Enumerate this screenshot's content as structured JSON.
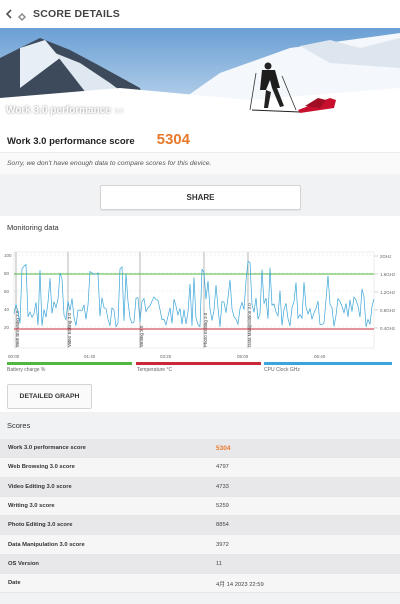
{
  "header": {
    "title": "SCORE DETAILS"
  },
  "hero": {
    "label": "Work 3.0 performance",
    "version": "3.0"
  },
  "score": {
    "label": "Work 3.0 performance score",
    "value": "5304"
  },
  "notice": "Sorry, we don't have enough data to compare scores for this device.",
  "share_label": "SHARE",
  "monitoring": {
    "title": "Monitoring data",
    "y_left_ticks": [
      "100",
      "80",
      "60",
      "40",
      "20"
    ],
    "y_right_ticks": [
      "2GHz",
      "1.6GHz",
      "1.2GHz",
      "0.8GHz",
      "0.4GHz"
    ],
    "x_ticks": [
      "00:00",
      "01:40",
      "03:20",
      "05:00",
      "06:40"
    ],
    "segment_labels": [
      "Web Browsing 3.0",
      "Video Editing 3.0",
      "Writing 3.0",
      "Photo Editing 3.0",
      "Data Manipulation 3.0"
    ],
    "legend": [
      {
        "label": "Battery charge %",
        "color": "#4fb83e"
      },
      {
        "label": "Temperature °C",
        "color": "#c8283a"
      },
      {
        "label": "CPU Clock GHz",
        "color": "#3aa5d8"
      }
    ]
  },
  "detailed_graph_label": "DETAILED GRAPH",
  "scores": {
    "title": "Scores",
    "rows": [
      {
        "name": "Work 3.0 performance score",
        "value": "5304"
      },
      {
        "name": "Web Browsing 3.0 score",
        "value": "4797"
      },
      {
        "name": "Video Editing 3.0 score",
        "value": "4733"
      },
      {
        "name": "Writing 3.0 score",
        "value": "5259"
      },
      {
        "name": "Photo Editing 3.0 score",
        "value": "8854"
      },
      {
        "name": "Data Manipulation 3.0 score",
        "value": "3972"
      },
      {
        "name": "OS Version",
        "value": "11"
      },
      {
        "name": "Date",
        "value": "4月 14 2023 22:59"
      }
    ]
  }
}
